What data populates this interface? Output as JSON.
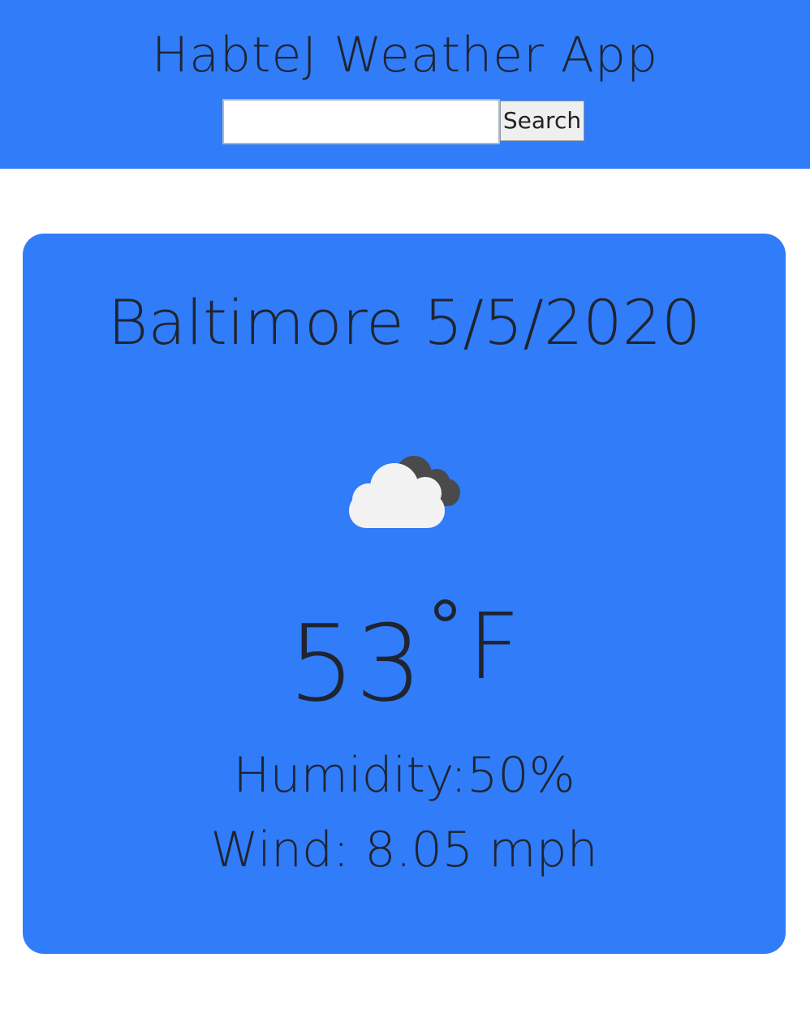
{
  "header": {
    "title": "HabteJ Weather App",
    "search": {
      "value": "",
      "placeholder": "",
      "button_label": "Search"
    }
  },
  "weather": {
    "city": "Baltimore",
    "date": "5/5/2020",
    "icon": "broken-clouds-icon",
    "temperature": "53",
    "temperature_unit": "˚F",
    "humidity": "Humidity:50%",
    "wind": "Wind: 8.05 mph"
  },
  "colors": {
    "primary_blue": "#317cf8",
    "text_dark": "#1f2430",
    "cloud_white": "#f2f2f2",
    "cloud_dark": "#4a4a4d"
  }
}
